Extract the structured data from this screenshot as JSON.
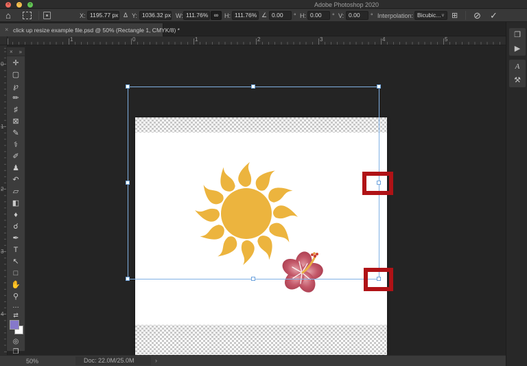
{
  "window": {
    "title": "Adobe Photoshop 2020",
    "close_glyph": "×",
    "minimize_glyph": "−",
    "zoom_glyph": "+"
  },
  "options_bar": {
    "home_icon": "⌂",
    "x_label": "X:",
    "x_value": "1195.77 px",
    "delta_icon": "Δ",
    "y_label": "Y:",
    "y_value": "1036.32 px",
    "w_label": "W:",
    "w_value": "111.76%",
    "link_icon": "∞",
    "h_label": "H:",
    "h_value": "111.76%",
    "angle_icon": "∠",
    "angle_value": "0.00",
    "hskew_label": "H:",
    "hskew_value": "0.00",
    "vskew_label": "V:",
    "vskew_value": "0.00",
    "degree": "°",
    "interpolation_label": "Interpolation:",
    "interpolation_value": "Bicubic...",
    "caret": "∨",
    "warp_icon": "⊞",
    "cancel_icon": "⊘",
    "commit_icon": "✓"
  },
  "tab": {
    "close": "×",
    "title": "click up resize example file.psd @ 50% (Rectangle 1, CMYK/8) *"
  },
  "rulers": {
    "top_labels": [
      "1",
      "0",
      "1",
      "2",
      "3",
      "4",
      "5"
    ],
    "left_labels": [
      "0",
      "1",
      "2",
      "3",
      "4"
    ]
  },
  "toolbar": {
    "close": "×",
    "collapse": "»",
    "tools": [
      {
        "name": "move",
        "glyph": "✛"
      },
      {
        "name": "rectangular-marquee",
        "glyph": "▢"
      },
      {
        "name": "lasso",
        "glyph": "℘"
      },
      {
        "name": "quick-selection",
        "glyph": "✏"
      },
      {
        "name": "crop",
        "glyph": "♯"
      },
      {
        "name": "frame",
        "glyph": "⊠"
      },
      {
        "name": "eyedropper",
        "glyph": "✎"
      },
      {
        "name": "spot-healing-brush",
        "glyph": "⚕"
      },
      {
        "name": "brush",
        "glyph": "✐"
      },
      {
        "name": "clone-stamp",
        "glyph": "♟"
      },
      {
        "name": "history-brush",
        "glyph": "↶"
      },
      {
        "name": "eraser",
        "glyph": "▱"
      },
      {
        "name": "gradient",
        "glyph": "◧"
      },
      {
        "name": "blur",
        "glyph": "♦"
      },
      {
        "name": "dodge",
        "glyph": "☌"
      },
      {
        "name": "pen",
        "glyph": "✒"
      },
      {
        "name": "type",
        "glyph": "T"
      },
      {
        "name": "path-selection",
        "glyph": "↖"
      },
      {
        "name": "rectangle-shape",
        "glyph": "□"
      },
      {
        "name": "hand",
        "glyph": "✋"
      },
      {
        "name": "zoom",
        "glyph": "⚲"
      }
    ],
    "ellipsis": "…",
    "swap_colors_icon": "⇄",
    "quick_mask_icon": "◎",
    "screen_mode_icon": "❐"
  },
  "right_dock": {
    "history_icon": "❐",
    "actions_icon": "▶",
    "paragraph_styles_icon": "A",
    "tool_presets_icon": "⚒"
  },
  "status_bar": {
    "zoom": "50%",
    "doc": "Doc: 22.0M/25.0M",
    "chevron": "›"
  },
  "colors": {
    "accent_blue": "#7fb0e4",
    "annotation_red": "#b01216",
    "sun_yellow": "#ecb43e",
    "flower_pink": "#c05261",
    "foreground_swatch": "#8678ca",
    "canvas_white": "#ffffff",
    "ui_dark": "#242424"
  }
}
